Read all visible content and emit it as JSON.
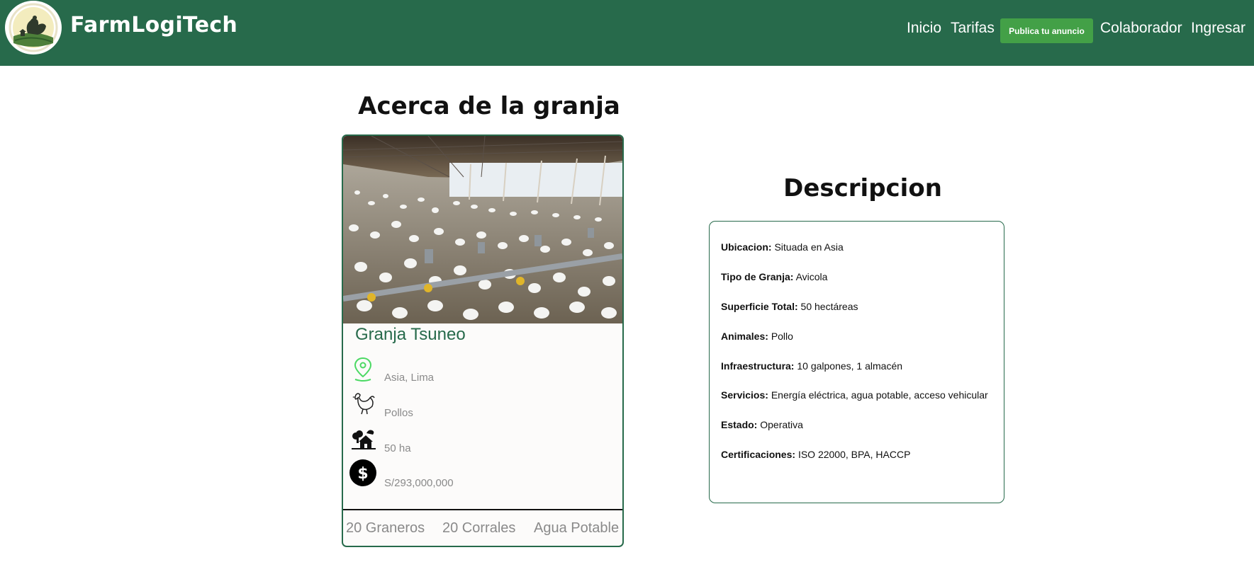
{
  "header": {
    "brand": "FarmLogiTech",
    "nav": {
      "inicio": "Inicio",
      "tarifas": "Tarifas",
      "publica": "Publica tu anuncio",
      "colaborador": "Colaborador",
      "ingresar": "Ingresar"
    }
  },
  "about": {
    "title": "Acerca de la granja",
    "card": {
      "name": "Granja Tsuneo",
      "location": "Asia, Lima",
      "animal": "Pollos",
      "area": "50 ha",
      "price": "S/293,000,000",
      "features": [
        "20 Graneros",
        "20 Corrales",
        "Agua Potable"
      ]
    }
  },
  "description": {
    "title": "Descripcion",
    "items": [
      {
        "label": "Ubicacion:",
        "value": "Situada en Asia"
      },
      {
        "label": "Tipo de Granja:",
        "value": "Avicola"
      },
      {
        "label": "Superficie Total:",
        "value": "50 hectáreas"
      },
      {
        "label": "Animales:",
        "value": "Pollo"
      },
      {
        "label": "Infraestructura:",
        "value": "10 galpones, 1 almacén"
      },
      {
        "label": "Servicios:",
        "value": "Energía eléctrica, agua potable, acceso vehicular"
      },
      {
        "label": "Estado:",
        "value": "Operativa"
      },
      {
        "label": "Certificaciones:",
        "value": "ISO 22000, BPA, HACCP"
      }
    ]
  },
  "colors": {
    "header": "#276a4b",
    "cta": "#43a047",
    "card_title": "#276a4b",
    "muted_text": "#8a8a8a",
    "location_icon": "#4cd964"
  },
  "icons": {
    "logo": "farm-hen-logo",
    "location": "map-pin-icon",
    "animal": "chicken-icon",
    "area": "farmhouse-icon",
    "price": "dollar-coin-icon"
  }
}
